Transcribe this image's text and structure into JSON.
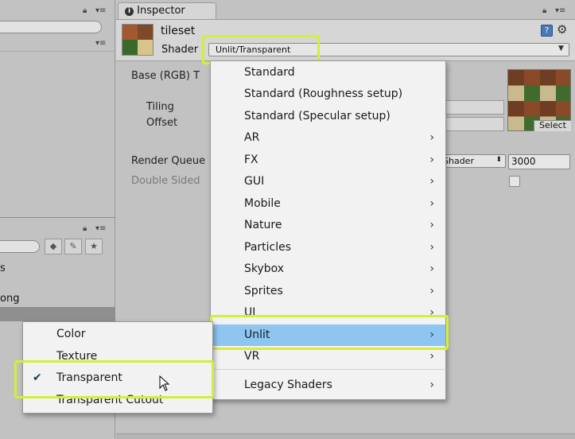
{
  "left_panel": {
    "list_items": [
      "ong"
    ],
    "partial_text": [
      "s"
    ]
  },
  "inspector": {
    "tab_label": "Inspector",
    "material_name": "tileset",
    "shader_label": "Shader",
    "shader_value": "Unlit/Transparent",
    "properties": {
      "base": "Base (RGB) T",
      "tiling": "Tiling",
      "offset": "Offset",
      "render_queue": "Render Queue",
      "double_sided": "Double Sided"
    },
    "render_queue_mode": "Shader",
    "render_queue_value": "3000",
    "texture_select_label": "Select"
  },
  "shader_menu": {
    "items": [
      {
        "label": "Standard",
        "submenu": false
      },
      {
        "label": "Standard (Roughness setup)",
        "submenu": false
      },
      {
        "label": "Standard (Specular setup)",
        "submenu": false
      },
      {
        "label": "AR",
        "submenu": true
      },
      {
        "label": "FX",
        "submenu": true
      },
      {
        "label": "GUI",
        "submenu": true
      },
      {
        "label": "Mobile",
        "submenu": true
      },
      {
        "label": "Nature",
        "submenu": true
      },
      {
        "label": "Particles",
        "submenu": true
      },
      {
        "label": "Skybox",
        "submenu": true
      },
      {
        "label": "Sprites",
        "submenu": true
      },
      {
        "label": "UI",
        "submenu": true
      },
      {
        "label": "Unlit",
        "submenu": true
      },
      {
        "label": "VR",
        "submenu": true
      },
      {
        "label": "Legacy Shaders",
        "submenu": true
      }
    ],
    "selected": "Unlit"
  },
  "unlit_submenu": {
    "items": [
      "Color",
      "Texture",
      "Transparent",
      "Transparent Cutout"
    ],
    "selected": "Transparent"
  },
  "icons": {
    "info": "info-icon",
    "help": "help-book-icon",
    "settings": "gear-icon",
    "lock": "lock-icon",
    "menu": "menu-icon",
    "submenu_arrow": "chevron-right-icon",
    "check": "checkmark-icon",
    "cursor": "mouse-pointer-icon"
  },
  "colors": {
    "highlight_outline": "#d4ee3a",
    "menu_selection": "#8ec5f1",
    "panel_bg": "#c2c2c2"
  }
}
